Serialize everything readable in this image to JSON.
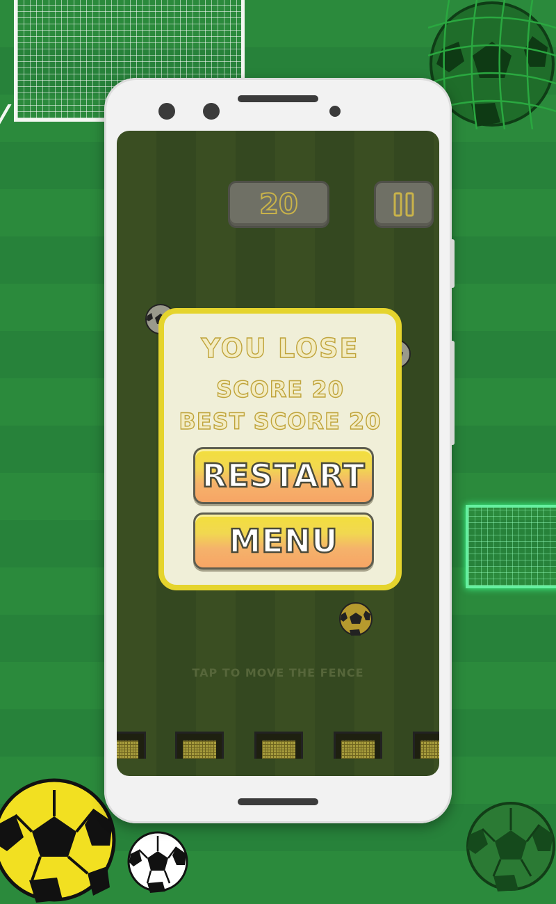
{
  "hud": {
    "score": "20",
    "pause_icon": "pause-icon"
  },
  "dialog": {
    "title": "YOU LOSE",
    "score_line": "SCORE 20",
    "best_line": "BEST SCORE 20",
    "restart_label": "RESTART",
    "menu_label": "MENU"
  },
  "hint": "TAP TO MOVE THE FENCE",
  "colors": {
    "field_green": "#2b8a3c",
    "dialog_border": "#e5d42d",
    "dialog_bg": "#f0efd8",
    "button_top": "#f3df3c",
    "button_bottom": "#f6a565"
  }
}
